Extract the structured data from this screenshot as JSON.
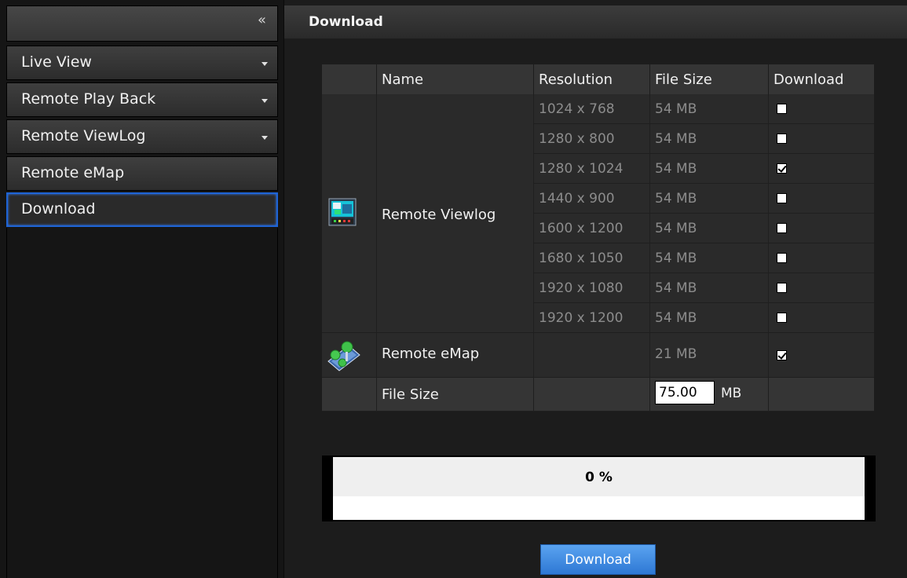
{
  "sidebar": {
    "collapse_glyph": "«",
    "items": [
      {
        "label": "Live View",
        "has_caret": true
      },
      {
        "label": "Remote Play Back",
        "has_caret": true
      },
      {
        "label": "Remote ViewLog",
        "has_caret": true
      },
      {
        "label": "Remote eMap",
        "has_caret": false
      },
      {
        "label": "Download",
        "has_caret": false,
        "active": true
      }
    ]
  },
  "main": {
    "title": "Download",
    "table": {
      "headers": [
        "Name",
        "Resolution",
        "File Size",
        "Download"
      ],
      "viewlog": {
        "icon": "viewlog-app-icon",
        "name": "Remote Viewlog",
        "rows": [
          {
            "resolution": "1024 x 768",
            "size": "54 MB",
            "checked": false
          },
          {
            "resolution": "1280 x 800",
            "size": "54 MB",
            "checked": false
          },
          {
            "resolution": "1280 x 1024",
            "size": "54 MB",
            "checked": true
          },
          {
            "resolution": "1440 x 900",
            "size": "54 MB",
            "checked": false
          },
          {
            "resolution": "1600 x 1200",
            "size": "54 MB",
            "checked": false
          },
          {
            "resolution": "1680 x 1050",
            "size": "54 MB",
            "checked": false
          },
          {
            "resolution": "1920 x 1080",
            "size": "54 MB",
            "checked": false
          },
          {
            "resolution": "1920 x 1200",
            "size": "54 MB",
            "checked": false
          }
        ]
      },
      "emap": {
        "icon": "emap-app-icon",
        "name": "Remote eMap",
        "size": "21 MB",
        "checked": true
      },
      "total": {
        "label": "File Size",
        "value": "75.00",
        "unit": "MB"
      }
    },
    "progress": {
      "percent": 0,
      "text": "0 %"
    },
    "download_button": "Download"
  },
  "colors": {
    "accent": "#2e78d4",
    "active_border": "#1e64d6"
  }
}
